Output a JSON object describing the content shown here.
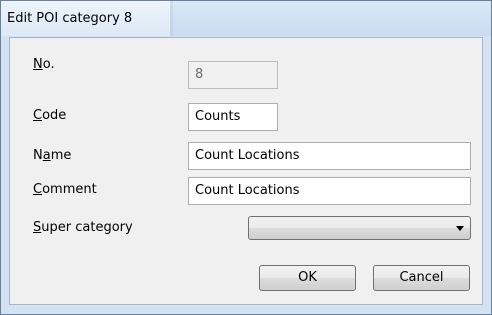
{
  "window": {
    "title": "Edit POI category 8"
  },
  "form": {
    "no": {
      "label_accel": "N",
      "label_rest": "o.",
      "value": "8"
    },
    "code": {
      "label_accel": "C",
      "label_rest": "ode",
      "value": "Counts"
    },
    "name": {
      "label_pre": "N",
      "label_accel": "a",
      "label_rest": "me",
      "value": "Count Locations"
    },
    "comment": {
      "label_accel": "C",
      "label_rest": "omment",
      "value": "Count Locations"
    },
    "super_category": {
      "label_accel": "S",
      "label_rest": "uper category",
      "selected": ""
    }
  },
  "buttons": {
    "ok": "OK",
    "cancel": "Cancel"
  },
  "icons": {
    "dropdown": "chevron-down-icon"
  }
}
